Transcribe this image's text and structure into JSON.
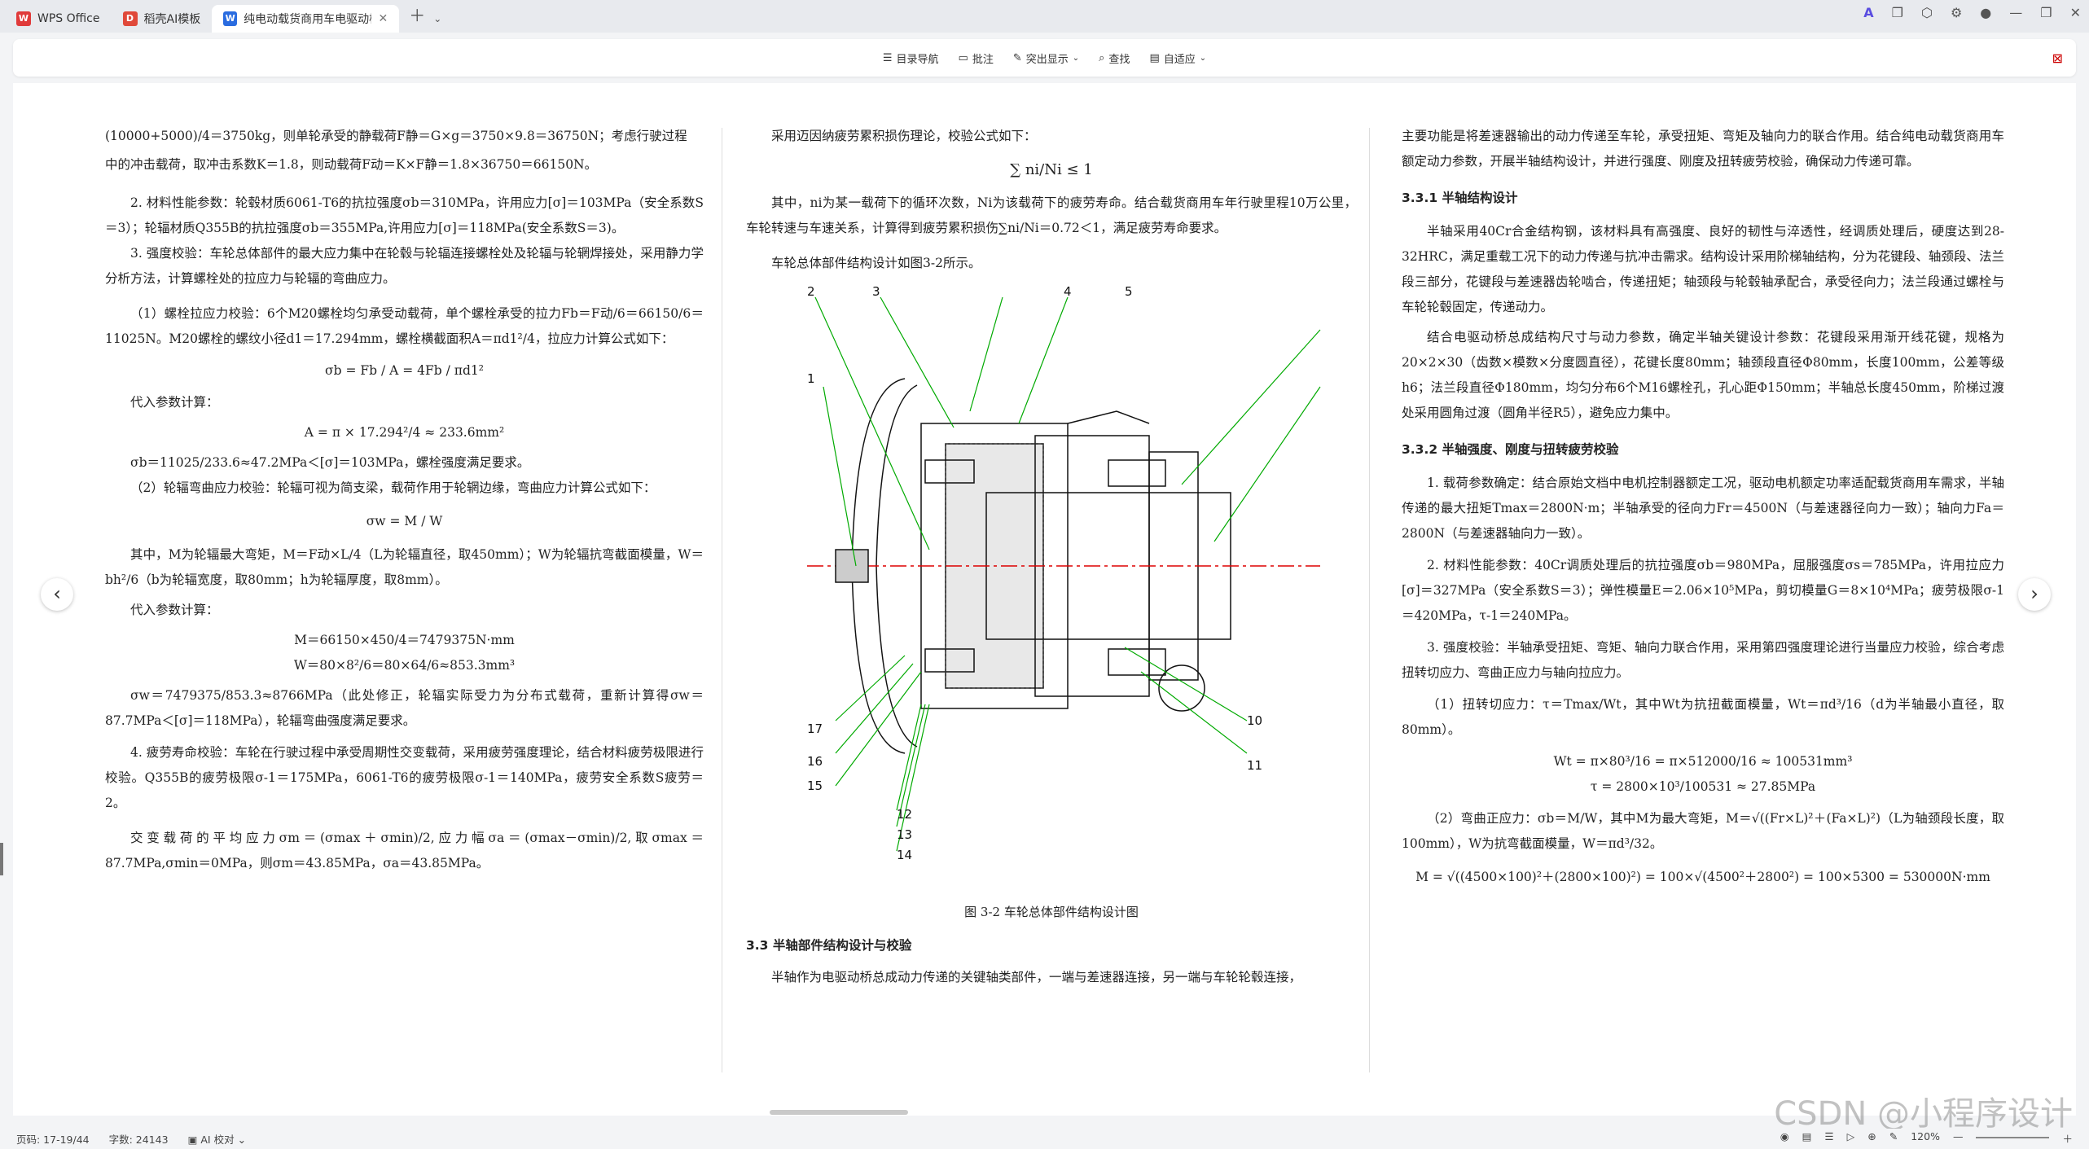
{
  "tabs": [
    {
      "label": "WPS Office",
      "icon": "wps-icon"
    },
    {
      "label": "稻壳AI模板",
      "icon": "docer-icon"
    },
    {
      "label": "纯电动载货商用车电驱动桥",
      "icon": "word-icon"
    }
  ],
  "toolbar": {
    "nav": "目录导航",
    "annotate": "批注",
    "highlight": "突出显示",
    "find": "查找",
    "fit": "自适应"
  },
  "status": {
    "page": "页码: 17-19/44",
    "words": "字数: 24143",
    "proof": "AI 校对",
    "zoom": "120%"
  },
  "watermark": "CSDN @小程序设计",
  "col1": {
    "p1": "(10000+5000)/4＝3750kg，则单轮承受的静载荷F静＝G×g＝3750×9.8＝36750N；考虑行驶过程",
    "p1b": "中的冲击载荷，取冲击系数K＝1.8，则动载荷F动＝K×F静＝1.8×36750＝66150N。",
    "p2": "2. 材料性能参数：轮毂材质6061-T6的抗拉强度σb＝310MPa，许用应力[σ]＝103MPa（安全系数S＝3）；轮辐材质Q355B的抗拉强度σb＝355MPa,许用应力[σ]＝118MPa(安全系数S＝3)。",
    "p3": "3. 强度校验：车轮总体部件的最大应力集中在轮毂与轮辐连接螺栓处及轮辐与轮辋焊接处，采用静力学分析方法，计算螺栓处的拉应力与轮辐的弯曲应力。",
    "p4": "（1）螺栓拉应力校验：6个M20螺栓均匀承受动载荷，单个螺栓承受的拉力Fb＝F动/6＝66150/6＝11025N。M20螺栓的螺纹小径d1＝17.294mm，螺栓横截面积A＝πd1²/4，拉应力计算公式如下：",
    "f1": "σb = Fb / A = 4Fb / πd1²",
    "p5": "代入参数计算：",
    "f2": "A = π × 17.294²/4 ≈ 233.6mm²",
    "p6": "σb＝11025/233.6≈47.2MPa＜[σ]＝103MPa，螺栓强度满足要求。",
    "p7": "（2）轮辐弯曲应力校验：轮辐可视为简支梁，载荷作用于轮辋边缘，弯曲应力计算公式如下：",
    "f3": "σw = M / W",
    "p8": "其中，M为轮辐最大弯矩，M＝F动×L/4（L为轮辐直径，取450mm）；W为轮辐抗弯截面模量，W＝bh²/6（b为轮辐宽度，取80mm；h为轮辐厚度，取8mm）。",
    "p9": "代入参数计算：",
    "f4": "M＝66150×450/4＝7479375N·mm",
    "f5": "W＝80×8²/6＝80×64/6≈853.3mm³",
    "p10": "σw＝7479375/853.3≈8766MPa（此处修正，轮辐实际受力为分布式载荷，重新计算得σw＝87.7MPa＜[σ]＝118MPa），轮辐弯曲强度满足要求。",
    "p11": "4. 疲劳寿命校验：车轮在行驶过程中承受周期性交变载荷，采用疲劳强度理论，结合材料疲劳极限进行校验。Q355B的疲劳极限σ-1＝175MPa，6061-T6的疲劳极限σ-1＝140MPa，疲劳安全系数S疲劳＝2。",
    "p12": "交变载荷的平均应力σm＝(σmax＋σmin)/2,应力幅σa＝(σmax－σmin)/2,取σmax＝87.7MPa,σmin＝0MPa，则σm＝43.85MPa，σa＝43.85MPa。"
  },
  "col2": {
    "p1": "采用迈因纳疲劳累积损伤理论，校验公式如下：",
    "f1": "∑ ni/Ni ≤ 1",
    "p2": "其中，ni为某一载荷下的循环次数，Ni为该载荷下的疲劳寿命。结合载货商用车年行驶里程10万公里，车轮转速与车速关系，计算得到疲劳累积损伤∑ni/Ni＝0.72＜1，满足疲劳寿命要求。",
    "p3": "车轮总体部件结构设计如图3-2所示。",
    "caption": "图 3-2  车轮总体部件结构设计图",
    "h1": "3.3  半轴部件结构设计与校验",
    "p4": "半轴作为电驱动桥总成动力传递的关键轴类部件，一端与差速器连接，另一端与车轮轮毂连接，",
    "labels": [
      "1",
      "2",
      "3",
      "4",
      "5",
      "10",
      "11",
      "12",
      "13",
      "14",
      "15",
      "16",
      "17"
    ]
  },
  "col3": {
    "p1": "主要功能是将差速器输出的动力传递至车轮，承受扭矩、弯矩及轴向力的联合作用。结合纯电动载货商用车额定动力参数，开展半轴结构设计，并进行强度、刚度及扭转疲劳校验，确保动力传递可靠。",
    "h1": "3.3.1  半轴结构设计",
    "p2": "半轴采用40Cr合金结构钢，该材料具有高强度、良好的韧性与淬透性，经调质处理后，硬度达到28-32HRC，满足重载工况下的动力传递与抗冲击需求。结构设计采用阶梯轴结构，分为花键段、轴颈段、法兰段三部分，花键段与差速器齿轮啮合，传递扭矩；轴颈段与轮毂轴承配合，承受径向力；法兰段通过螺栓与车轮轮毂固定，传递动力。",
    "p3": "结合电驱动桥总成结构尺寸与动力参数，确定半轴关键设计参数：花键段采用渐开线花键，规格为20×2×30（齿数×模数×分度圆直径），花键长度80mm；轴颈段直径Φ80mm，长度100mm，公差等级h6；法兰段直径Φ180mm，均匀分布6个M16螺栓孔，孔心距Φ150mm；半轴总长度450mm，阶梯过渡处采用圆角过渡（圆角半径R5），避免应力集中。",
    "h2": "3.3.2  半轴强度、刚度与扭转疲劳校验",
    "p4": "1. 载荷参数确定：结合原始文档中电机控制器额定工况，驱动电机额定功率适配载货商用车需求，半轴传递的最大扭矩Tmax＝2800N·m；半轴承受的径向力Fr＝4500N（与差速器径向力一致）；轴向力Fa＝2800N（与差速器轴向力一致）。",
    "p5": "2. 材料性能参数：40Cr调质处理后的抗拉强度σb＝980MPa，屈服强度σs＝785MPa，许用拉应力[σ]＝327MPa（安全系数S＝3）；弹性模量E＝2.06×10⁵MPa，剪切模量G＝8×10⁴MPa；疲劳极限σ-1＝420MPa，τ-1＝240MPa。",
    "p6": "3. 强度校验：半轴承受扭矩、弯矩、轴向力联合作用，采用第四强度理论进行当量应力校验，综合考虑扭转切应力、弯曲正应力与轴向拉应力。",
    "p7": "（1）扭转切应力：τ＝Tmax/Wt，其中Wt为抗扭截面模量，Wt＝πd³/16（d为半轴最小直径，取80mm）。",
    "f1": "Wt = π×80³/16 = π×512000/16 ≈ 100531mm³",
    "f2": "τ = 2800×10³/100531 ≈ 27.85MPa",
    "p8": "（2）弯曲正应力：σb＝M/W，其中M为最大弯矩，M＝√((Fr×L)²＋(Fa×L)²)（L为轴颈段长度，取100mm），W为抗弯截面模量，W＝πd³/32。",
    "f3": "M = √((4500×100)²＋(2800×100)²) = 100×√(4500²＋2800²) = 100×5300 = 530000N·mm"
  }
}
